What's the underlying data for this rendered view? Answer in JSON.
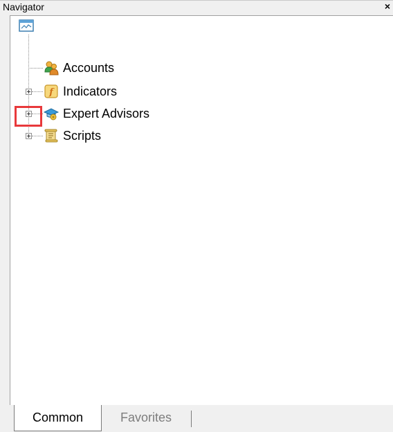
{
  "window": {
    "title": "Navigator",
    "close_label": "×"
  },
  "tree": {
    "root_icon": "terminal-icon",
    "items": [
      {
        "label": "Accounts",
        "icon": "accounts-icon",
        "expandable": false
      },
      {
        "label": "Indicators",
        "icon": "indicators-icon",
        "expandable": true
      },
      {
        "label": "Expert Advisors",
        "icon": "expert-advisors-icon",
        "expandable": true,
        "highlighted": true
      },
      {
        "label": "Scripts",
        "icon": "scripts-icon",
        "expandable": true
      }
    ]
  },
  "tabs": [
    {
      "label": "Common",
      "active": true
    },
    {
      "label": "Favorites",
      "active": false
    }
  ],
  "colors": {
    "highlight": "#e8393b",
    "inactive_tab_text": "#7d7d7d"
  }
}
